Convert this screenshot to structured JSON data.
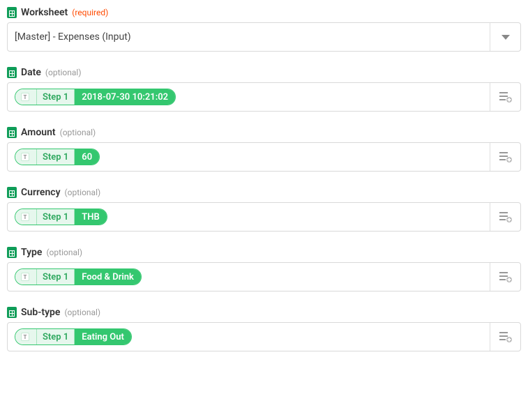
{
  "fields": [
    {
      "id": "worksheet",
      "label": "Worksheet",
      "requirement": "required",
      "req_text": "(required)",
      "type": "dropdown",
      "value": "[Master] - Expenses (Input)"
    },
    {
      "id": "date",
      "label": "Date",
      "requirement": "optional",
      "req_text": "(optional)",
      "type": "field",
      "step_label": "Step 1",
      "step_value": "2018-07-30 10:21:02"
    },
    {
      "id": "amount",
      "label": "Amount",
      "requirement": "optional",
      "req_text": "(optional)",
      "type": "field",
      "step_label": "Step 1",
      "step_value": "60"
    },
    {
      "id": "currency",
      "label": "Currency",
      "requirement": "optional",
      "req_text": "(optional)",
      "type": "field",
      "step_label": "Step 1",
      "step_value": "THB"
    },
    {
      "id": "type",
      "label": "Type",
      "requirement": "optional",
      "req_text": "(optional)",
      "type": "field",
      "step_label": "Step 1",
      "step_value": "Food & Drink"
    },
    {
      "id": "subtype",
      "label": "Sub-type",
      "requirement": "optional",
      "req_text": "(optional)",
      "type": "field",
      "step_label": "Step 1",
      "step_value": "Eating Out"
    }
  ],
  "type_marker": "T"
}
